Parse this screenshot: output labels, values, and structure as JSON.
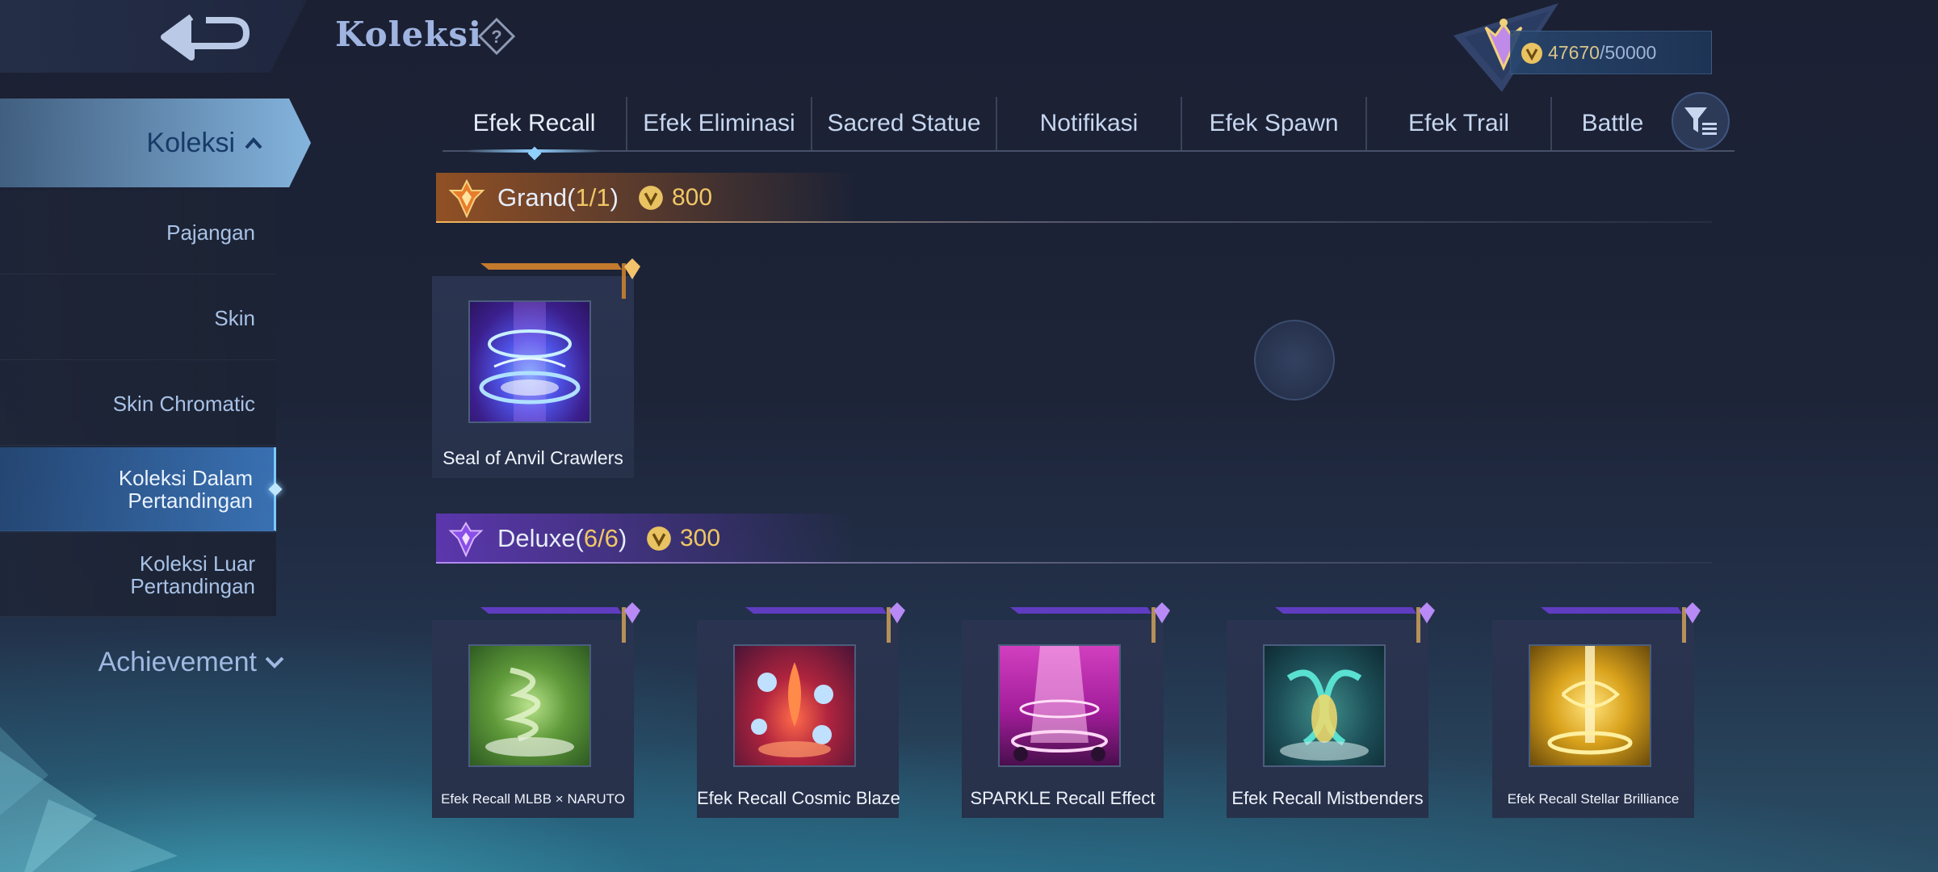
{
  "header": {
    "title": "Koleksi",
    "currency_current": "47670",
    "currency_max": "/50000"
  },
  "sidebar": {
    "active": "Koleksi",
    "items": [
      {
        "label": "Pajangan"
      },
      {
        "label": "Skin"
      },
      {
        "label": "Skin Chromatic"
      },
      {
        "label": "Koleksi Dalam Pertandingan"
      },
      {
        "label": "Koleksi Luar Pertandingan"
      }
    ],
    "achievement": "Achievement"
  },
  "tabs": [
    "Efek Recall",
    "Efek Eliminasi",
    "Sacred Statue",
    "Notifikasi",
    "Efek Spawn",
    "Efek Trail",
    "Battle"
  ],
  "sections": {
    "grand": {
      "title": "Grand(",
      "count": "1/1",
      "close": ")",
      "price": "800"
    },
    "deluxe": {
      "title": "Deluxe(",
      "count": "6/6",
      "close": ")",
      "price": "300"
    }
  },
  "grand_items": [
    {
      "name": "Seal of Anvil Crawlers"
    }
  ],
  "deluxe_items": [
    {
      "name": "Efek Recall MLBB × NARUTO"
    },
    {
      "name": "Efek Recall Cosmic Blaze"
    },
    {
      "name": "SPARKLE Recall Effect"
    },
    {
      "name": "Efek Recall Mistbenders"
    },
    {
      "name": "Efek Recall Stellar Brilliance"
    }
  ],
  "colors": {
    "gold": "#f0c766",
    "accent_blue": "#8fd0ff",
    "grand_ribbon": "#e08a2c",
    "deluxe_ribbon": "#6a3fd6"
  },
  "icons": [
    "back-arrow-icon",
    "question-icon",
    "rank-emblem-icon",
    "coin-icon",
    "chevron-up-icon",
    "chevron-down-icon",
    "filter-icon",
    "grand-tier-icon",
    "deluxe-tier-icon"
  ]
}
